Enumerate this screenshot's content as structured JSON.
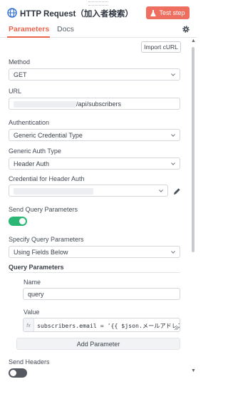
{
  "header": {
    "title": "HTTP Request（加入者検索）",
    "test_step_label": "Test step"
  },
  "tabs": [
    {
      "label": "Parameters",
      "active": true
    },
    {
      "label": "Docs",
      "active": false
    }
  ],
  "import_curl_label": "Import cURL",
  "method": {
    "label": "Method",
    "value": "GET"
  },
  "url": {
    "label": "URL",
    "value": "/api/subscribers"
  },
  "authentication": {
    "label": "Authentication",
    "value": "Generic Credential Type"
  },
  "generic_auth_type": {
    "label": "Generic Auth Type",
    "value": "Header Auth"
  },
  "credential": {
    "label": "Credential for Header Auth",
    "value": ""
  },
  "send_query_parameters": {
    "label": "Send Query Parameters",
    "enabled": true
  },
  "specify_query_parameters": {
    "label": "Specify Query Parameters",
    "value": "Using Fields Below"
  },
  "query_parameters": {
    "title": "Query Parameters",
    "name_label": "Name",
    "name_value": "query",
    "value_label": "Value",
    "value_fx": "fx",
    "value_expression": "subscribers.email = '{{ $json.メールアドレス }}'",
    "add_label": "Add Parameter"
  },
  "send_headers": {
    "label": "Send Headers",
    "enabled": false
  },
  "colors": {
    "accent": "#ee6f60",
    "tab_active": "#e8664f",
    "toggle_on": "#2ab673",
    "toggle_off": "#55595f"
  },
  "icons": [
    "globe-icon",
    "flask-icon",
    "gear-icon",
    "chevron-down-icon",
    "pencil-icon",
    "resize-handle-icon"
  ]
}
